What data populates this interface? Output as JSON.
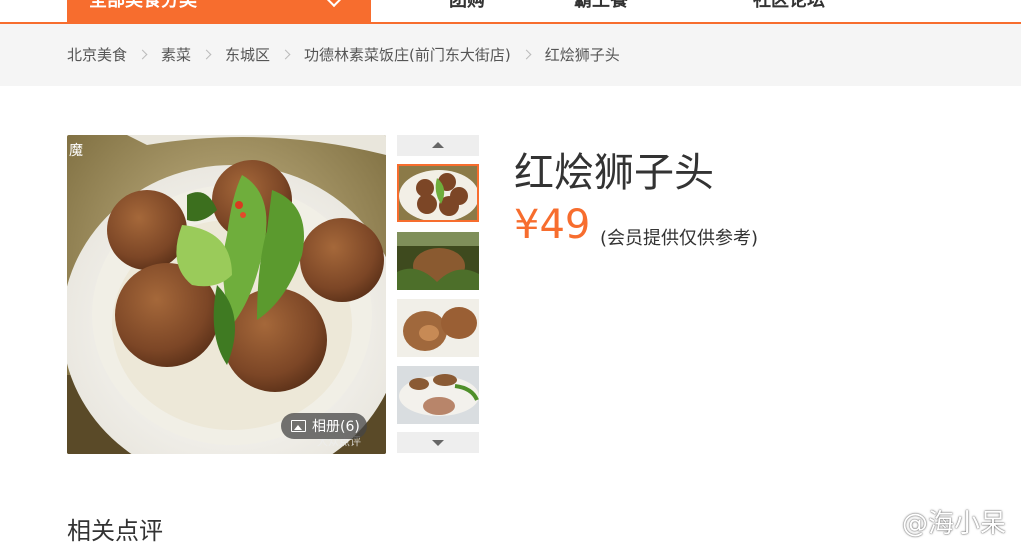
{
  "nav": {
    "category_menu": "全部美食分类",
    "links": [
      "团购",
      "霸王餐",
      "社区论坛"
    ]
  },
  "breadcrumb": [
    "北京美食",
    "素菜",
    "东城区",
    "功德林素菜饭庄(前门东大街店)",
    "红烩狮子头"
  ],
  "dish": {
    "title": "红烩狮子头",
    "price": "¥49",
    "price_note": "(会员提供仅供参考)"
  },
  "gallery": {
    "album_label": "相册(6)",
    "photo_corner_text": "魔",
    "photo_watermark": "大众点评",
    "thumbnail_count": 4
  },
  "section": {
    "related_reviews": "相关点评"
  },
  "watermark": {
    "text": "@海小呆"
  },
  "colors": {
    "accent": "#f76d2e",
    "crumb_bg": "#f5f5f5"
  }
}
